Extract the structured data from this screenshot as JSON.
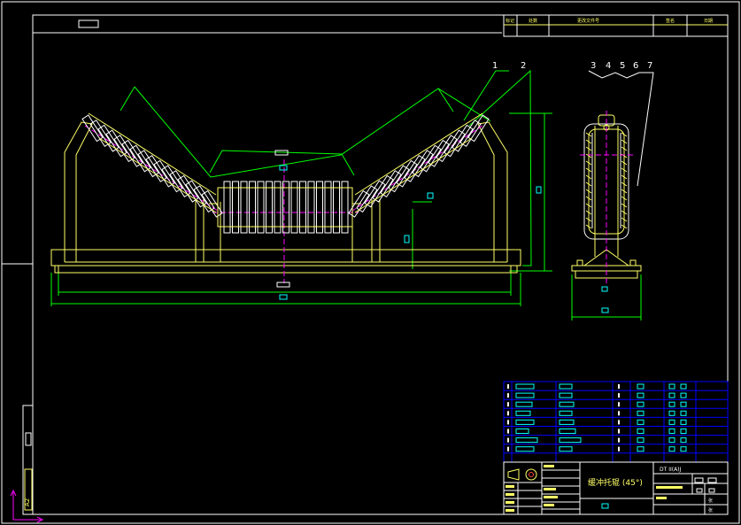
{
  "colors": {
    "background": "#000000",
    "frame": "#FFFFFF",
    "outline": "#FFFF66",
    "rollers": "#FFFFFF",
    "dimension": "#00FF00",
    "centerline": "#FF00FF",
    "annotation": "#00FFFF",
    "table_lines": "#0000FF"
  },
  "callouts": {
    "front": [
      "1",
      "2"
    ],
    "side": [
      "3",
      "4",
      "5",
      "6",
      "7"
    ]
  },
  "title_block": {
    "drawing_name": "缓冲托辊 (45°)",
    "drawing_code": "DT II(A)J",
    "sheet_label_1": "张",
    "sheet_label_2": "张"
  },
  "top_table": {
    "headers": [
      "标记",
      "处数",
      "更改文件号",
      "签名",
      "日期"
    ]
  },
  "side_label": "A2"
}
